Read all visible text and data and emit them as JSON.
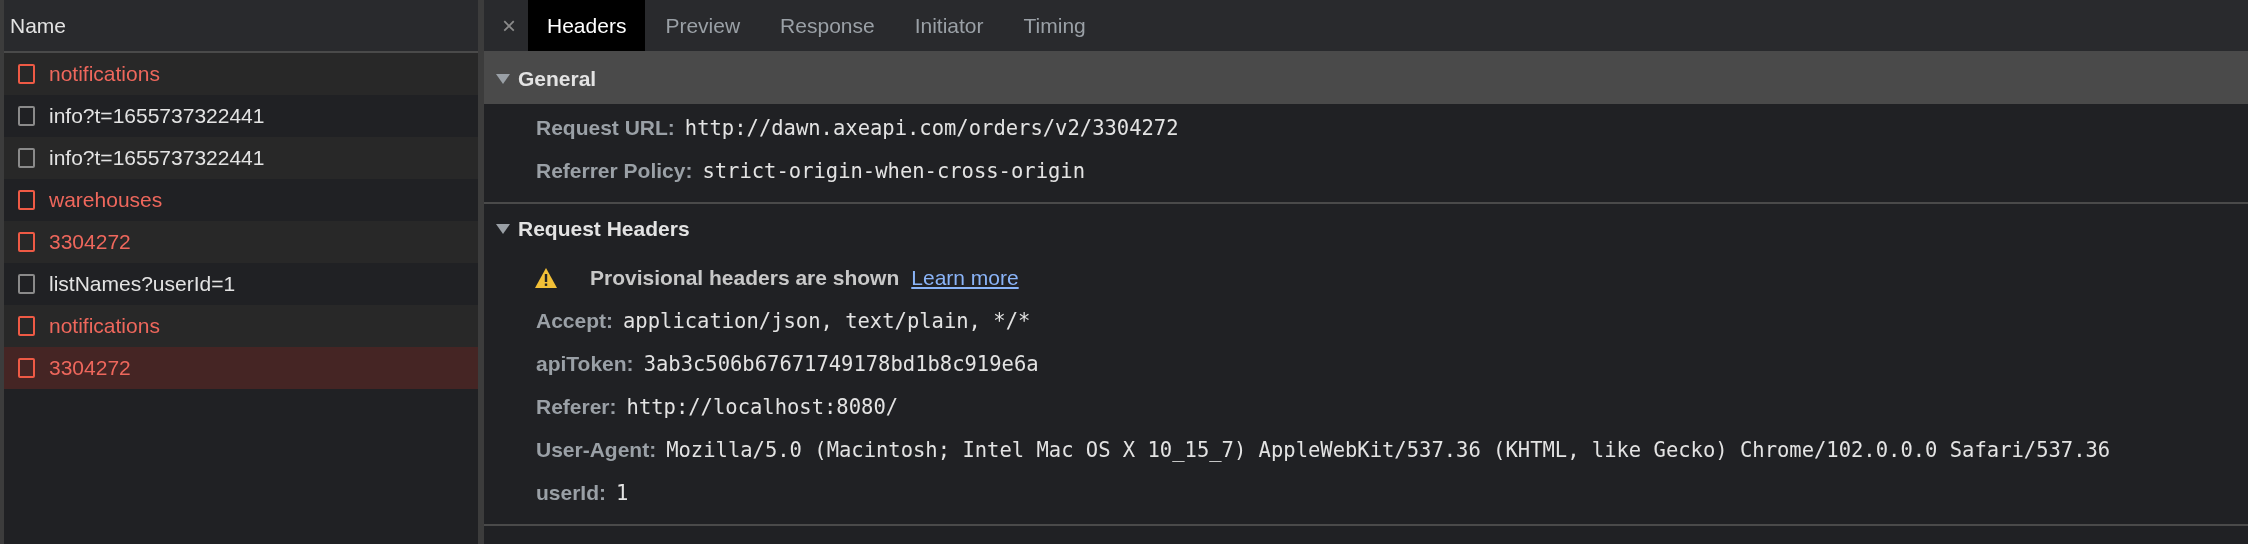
{
  "requests": {
    "column": "Name",
    "rows": [
      {
        "name": "notifications",
        "failed": true,
        "selected": false
      },
      {
        "name": "info?t=1655737322441",
        "failed": false,
        "selected": false
      },
      {
        "name": "info?t=1655737322441",
        "failed": false,
        "selected": false
      },
      {
        "name": "warehouses",
        "failed": true,
        "selected": false
      },
      {
        "name": "3304272",
        "failed": true,
        "selected": false
      },
      {
        "name": "listNames?userId=1",
        "failed": false,
        "selected": false
      },
      {
        "name": "notifications",
        "failed": true,
        "selected": false
      },
      {
        "name": "3304272",
        "failed": true,
        "selected": true
      }
    ]
  },
  "tabs": [
    {
      "label": "Headers",
      "selected": true
    },
    {
      "label": "Preview",
      "selected": false
    },
    {
      "label": "Response",
      "selected": false
    },
    {
      "label": "Initiator",
      "selected": false
    },
    {
      "label": "Timing",
      "selected": false
    }
  ],
  "close_tab": "×",
  "sections": [
    {
      "title": "General",
      "expanded": true,
      "highlighted": true,
      "fields": [
        {
          "key": "Request URL:",
          "value": "http://dawn.axeapi.com/orders/v2/3304272"
        },
        {
          "key": "Referrer Policy:",
          "value": "strict-origin-when-cross-origin"
        }
      ]
    },
    {
      "title": "Request Headers",
      "expanded": true,
      "highlighted": false,
      "warning": {
        "text": "Provisional headers are shown",
        "link": "Learn more"
      },
      "fields": [
        {
          "key": "Accept:",
          "value": "application/json, text/plain, */*"
        },
        {
          "key": "apiToken:",
          "value": "3ab3c506b67671749178bd1b8c919e6a"
        },
        {
          "key": "Referer:",
          "value": "http://localhost:8080/"
        },
        {
          "key": "User-Agent:",
          "value": "Mozilla/5.0 (Macintosh; Intel Mac OS X 10_15_7) AppleWebKit/537.36 (KHTML, like Gecko) Chrome/102.0.0.0 Safari/537.36"
        },
        {
          "key": "userId:",
          "value": "1"
        }
      ]
    }
  ]
}
